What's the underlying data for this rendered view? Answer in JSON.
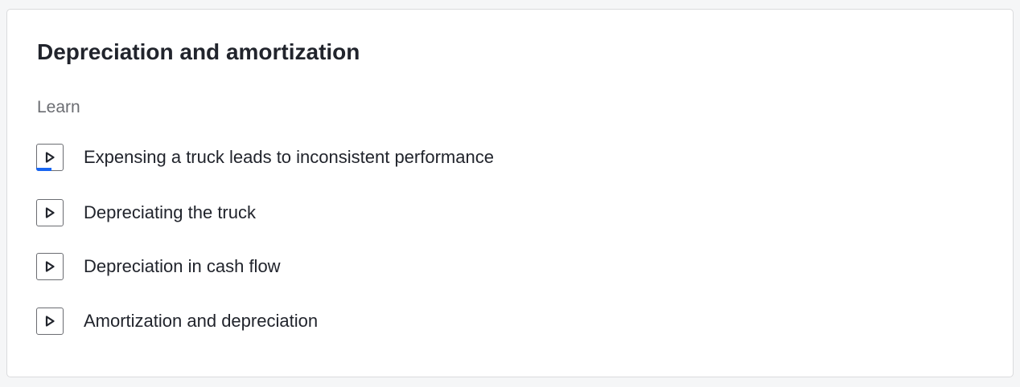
{
  "unit": {
    "title": "Depreciation and amortization",
    "section_label": "Learn"
  },
  "lessons": [
    {
      "label": "Expensing a truck leads to inconsistent performance",
      "icon": "play-icon",
      "progress_fraction": 0.55
    },
    {
      "label": "Depreciating the truck",
      "icon": "play-icon",
      "progress_fraction": 0
    },
    {
      "label": "Depreciation in cash flow",
      "icon": "play-icon",
      "progress_fraction": 0
    },
    {
      "label": "Amortization and depreciation",
      "icon": "play-icon",
      "progress_fraction": 0
    }
  ],
  "colors": {
    "progress": "#1865f2",
    "text": "#21242c",
    "muted": "#6b6d72",
    "border": "#dadbdd"
  }
}
